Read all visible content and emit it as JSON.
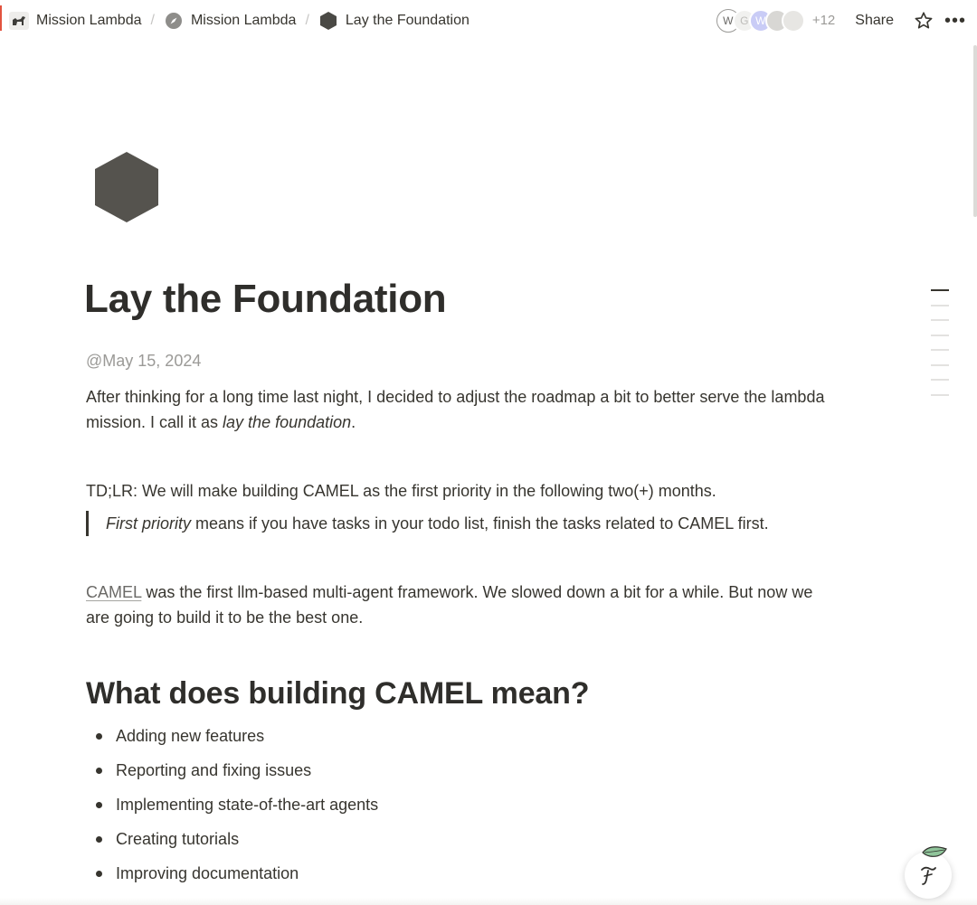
{
  "breadcrumbs": [
    {
      "label": "Mission Lambda",
      "icon": "camel-icon"
    },
    {
      "label": "Mission Lambda",
      "icon": "compass-icon"
    },
    {
      "label": "Lay the Foundation",
      "icon": "hexagon-icon"
    }
  ],
  "breadcrumb_separator": "/",
  "collaborators": {
    "avatars": [
      "W",
      "G",
      "W",
      "",
      ""
    ],
    "more_count": "+12"
  },
  "toolbar": {
    "share_label": "Share",
    "favorite_icon": "star-icon",
    "more_icon": "more-horizontal-icon",
    "more_glyph": "•••"
  },
  "page": {
    "icon": "hexagon-icon",
    "icon_color": "#55534e",
    "title": "Lay the Foundation",
    "date_mention": "@May 15, 2024",
    "intro_part1": "After thinking for a long time last night, I decided to adjust the roadmap a bit to better serve the lambda mission. I call it as ",
    "intro_italic": "lay the foundation",
    "intro_end": ".",
    "tldr": "TD;LR: We will make building CAMEL as the first priority in the following two(+) months.",
    "quote_italic": "First priority",
    "quote_rest": " means if you have tasks in your todo list, finish the tasks related to CAMEL first.",
    "camel_link": "CAMEL",
    "camel_text": " was the first llm-based multi-agent framework. We slowed down a bit for a while. But now we are going to build it to be the best one.",
    "heading": "What does building CAMEL mean?",
    "bullets": [
      "Adding new features",
      "Reporting and fixing issues",
      "Implementing state-of-the-art agents",
      "Creating tutorials",
      "Improving documentation"
    ]
  },
  "help_button_icon": "notion-ai-face-icon"
}
